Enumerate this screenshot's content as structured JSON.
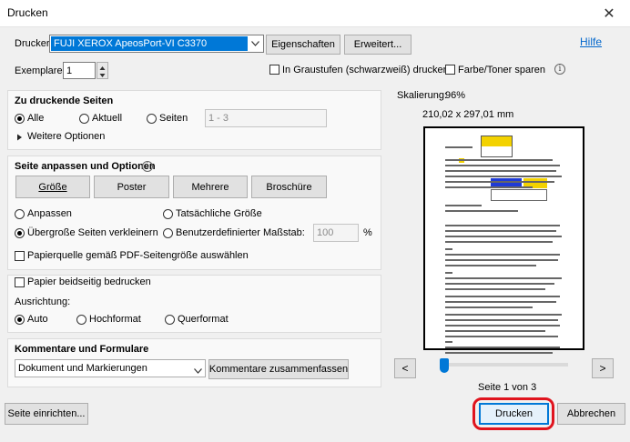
{
  "window": {
    "title": "Drucken",
    "close_glyph": "✕"
  },
  "header": {
    "printer_label": "Drucker:",
    "printer_value": "FUJI XEROX ApeosPort-VI C3370",
    "properties_button": "Eigenschaften",
    "advanced_button": "Erweitert...",
    "help_link": "Hilfe",
    "copies_label": "Exemplare:",
    "copies_value": "1",
    "grayscale_label": "In Graustufen (schwarzweiß) drucken",
    "save_ink_label": "Farbe/Toner sparen"
  },
  "pages_section": {
    "title": "Zu druckende Seiten",
    "all_label": "Alle",
    "current_label": "Aktuell",
    "pages_label": "Seiten",
    "pages_range": "1 - 3",
    "more_options": "Weitere Optionen",
    "selected": "Alle"
  },
  "fit_section": {
    "title": "Seite anpassen und Optionen",
    "tabs": [
      "Größe",
      "Poster",
      "Mehrere",
      "Broschüre"
    ],
    "fit_label": "Anpassen",
    "actual_size_label": "Tatsächliche Größe",
    "shrink_label": "Übergroße Seiten verkleinern",
    "custom_scale_label": "Benutzerdefinierter Maßstab:",
    "scale_value": "100",
    "scale_unit": "%",
    "paper_source_label": "Papierquelle gemäß PDF-Seitengröße auswählen",
    "selected": "Übergroße Seiten verkleinern"
  },
  "duplex": {
    "label": "Papier beidseitig bedrucken"
  },
  "orientation": {
    "title": "Ausrichtung:",
    "auto_label": "Auto",
    "portrait_label": "Hochformat",
    "landscape_label": "Querformat",
    "selected": "Auto"
  },
  "comments": {
    "title": "Kommentare und Formulare",
    "value": "Dokument und Markierungen",
    "summarize_button": "Kommentare zusammenfassen"
  },
  "preview": {
    "scaling_label": "Skalierung:",
    "scaling_value": "96%",
    "page_size": "210,02 x 297,01 mm",
    "prev": "<",
    "next": ">",
    "page_indicator": "Seite 1 von 3",
    "slider_fraction": 0
  },
  "footer": {
    "page_setup_button": "Seite einrichten...",
    "print_button": "Drucken",
    "cancel_button": "Abbrechen"
  },
  "colors": {
    "accent": "#0078d7",
    "selection": "#0078d7",
    "highlight_ring": "#e0141e",
    "help_link": "#0066cc"
  }
}
